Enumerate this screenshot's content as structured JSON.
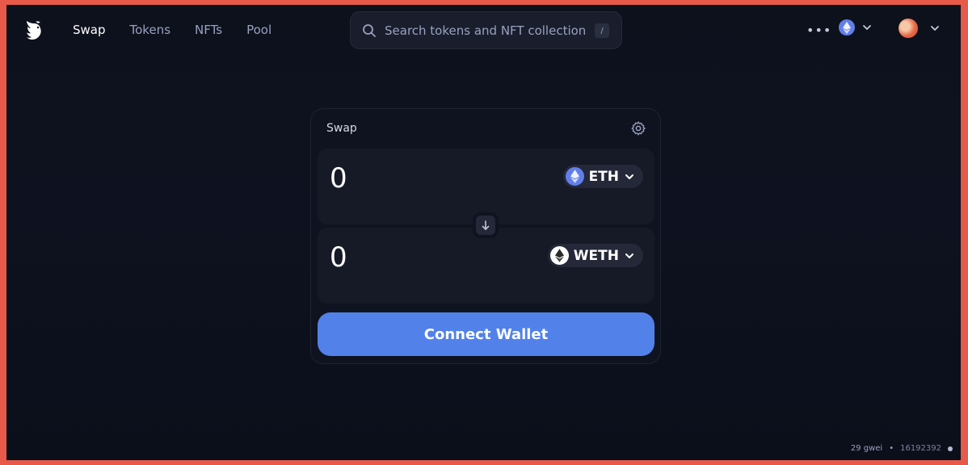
{
  "nav": {
    "items": [
      {
        "label": "Swap",
        "active": true
      },
      {
        "label": "Tokens",
        "active": false
      },
      {
        "label": "NFTs",
        "active": false
      },
      {
        "label": "Pool",
        "active": false
      }
    ]
  },
  "search": {
    "placeholder": "Search tokens and NFT collection",
    "shortcut": "/"
  },
  "header": {
    "more_label": "•••",
    "chain_icon": "ethereum-icon",
    "account_icon": "avatar"
  },
  "swap": {
    "title": "Swap",
    "input": {
      "amount": "0",
      "token": "ETH"
    },
    "output": {
      "amount": "0",
      "token": "WETH"
    },
    "connect_label": "Connect Wallet"
  },
  "status": {
    "gas": "29 gwei",
    "separator": "•",
    "block": "16192392"
  },
  "colors": {
    "background": "#0d111c",
    "accent": "#5281ea",
    "eth": "#627eea",
    "frame": "#e8594a"
  }
}
